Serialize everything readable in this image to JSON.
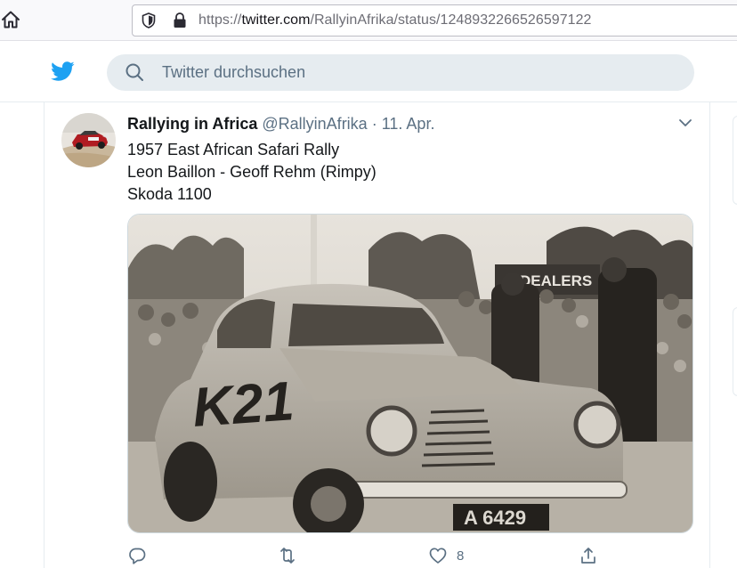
{
  "browser": {
    "url_prefix": "https://",
    "url_host": "twitter.com",
    "url_path": "/RallyinAfrika/status/1248932266526597122"
  },
  "header": {
    "search_placeholder": "Twitter durchsuchen",
    "brand_color": "#1da1f2"
  },
  "tweet": {
    "display_name": "Rallying in Africa",
    "handle": "@RallyinAfrika",
    "separator": "·",
    "date": "11. Apr.",
    "lines": [
      "1957 East African Safari Rally",
      "Leon Baillon - Geoff Rehm (Rimpy)",
      "Skoda 1100"
    ],
    "photo_text": {
      "door_number": "K21",
      "plate": "A 6429",
      "sign": "DEALERS"
    },
    "actions": {
      "reply_icon": "reply-icon",
      "retweet_icon": "retweet-icon",
      "like_icon": "heart-icon",
      "like_count": "8",
      "share_icon": "share-icon"
    }
  }
}
